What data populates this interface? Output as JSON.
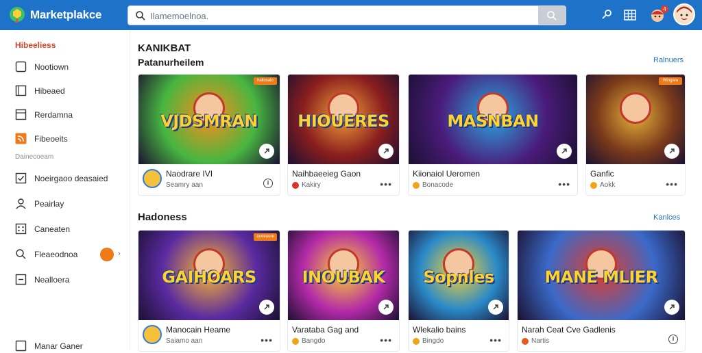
{
  "app": {
    "brand": "Marketplakce"
  },
  "search": {
    "placeholder": "Ilamemoelnoa."
  },
  "sidebar": {
    "heading": "Hibeeliess",
    "items": [
      {
        "label": "Nootiown",
        "icon": "square-icon"
      },
      {
        "label": "Hibeaed",
        "icon": "panel-icon"
      },
      {
        "label": "Rerdamna",
        "icon": "box-icon"
      },
      {
        "label": "Fibeoeits",
        "icon": "rss-icon"
      }
    ],
    "section_label": "Dainecoeam",
    "items2": [
      {
        "label": "Noeirgaoo deasaied",
        "icon": "check-square-icon"
      },
      {
        "label": "Peairlay",
        "icon": "user-icon"
      },
      {
        "label": "Caneaten",
        "icon": "grid-icon"
      },
      {
        "label": "Fleaeodnoa",
        "icon": "search-icon"
      },
      {
        "label": "Nealloera",
        "icon": "minus-square-icon"
      },
      {
        "label": "Manar Ganer",
        "icon": "square-icon"
      }
    ]
  },
  "main": {
    "section1": {
      "title": "KANIKBAT",
      "subtitle": "Patanurheilem",
      "see_all": "Ralnuers"
    },
    "section2": {
      "title": "Hadoness",
      "see_all": "Kanlces"
    },
    "row1": [
      {
        "thumb_text": "VJDSMRAN",
        "title": "Naodrare IVI",
        "sub": "Seamry aan",
        "tag": "hellosalo",
        "bg": "#47b640",
        "accent": "#ff8c1a",
        "dot": "#e6a11a",
        "action": "info"
      },
      {
        "thumb_text": "HIOUERES",
        "title": "Naihbaeeieg Gaon",
        "sub": "Kakiry",
        "tag": "",
        "bg": "#8a1e1e",
        "accent": "#f0a13a",
        "dot": "#d8342c",
        "action": "more"
      },
      {
        "thumb_text": "MASNBAN",
        "title": "Kiionaiol Ueromen",
        "sub": "Bonacode",
        "tag": "",
        "bg": "#4a1b7a",
        "accent": "#2aa8e0",
        "dot": "#f0a41a",
        "action": "more"
      },
      {
        "thumb_text": "",
        "title": "Ganfic",
        "sub": "Aokk",
        "tag": "Wingare",
        "bg": "#7a3a1a",
        "accent": "#e6b23a",
        "dot": "#f0a41a",
        "action": "more"
      }
    ],
    "row2": [
      {
        "thumb_text": "GAIHOARS",
        "title": "Manocain Heame",
        "sub": "Saiamo aan",
        "tag": "aueeuore",
        "bg": "#5a2aa0",
        "accent": "#ffb82e",
        "dot": "#e6a11a",
        "action": "more"
      },
      {
        "thumb_text": "INOUBAK",
        "title": "Varataba Gag and",
        "sub": "Bangdo",
        "tag": "",
        "bg": "#b32aa8",
        "accent": "#ffd22e",
        "dot": "#f0a41a",
        "action": "more"
      },
      {
        "thumb_text": "Sopnles",
        "title": "Wlekalio bains",
        "sub": "Bingdo",
        "tag": "",
        "bg": "#2a8ac8",
        "accent": "#ffd22e",
        "dot": "#f0a41a",
        "action": "more"
      },
      {
        "thumb_text": "MANE MLIER",
        "title": "Narah Ceat Cve Gadlenis",
        "sub": "Nartis",
        "tag": "",
        "bg": "#3a6ac8",
        "accent": "#e23b2a",
        "dot": "#e65a1a",
        "action": "info"
      }
    ]
  },
  "colors": {
    "topbar": "#1e73c8",
    "accent": "#ee7a1a",
    "link": "#1e73c8",
    "sidebar_head": "#d9452b"
  }
}
